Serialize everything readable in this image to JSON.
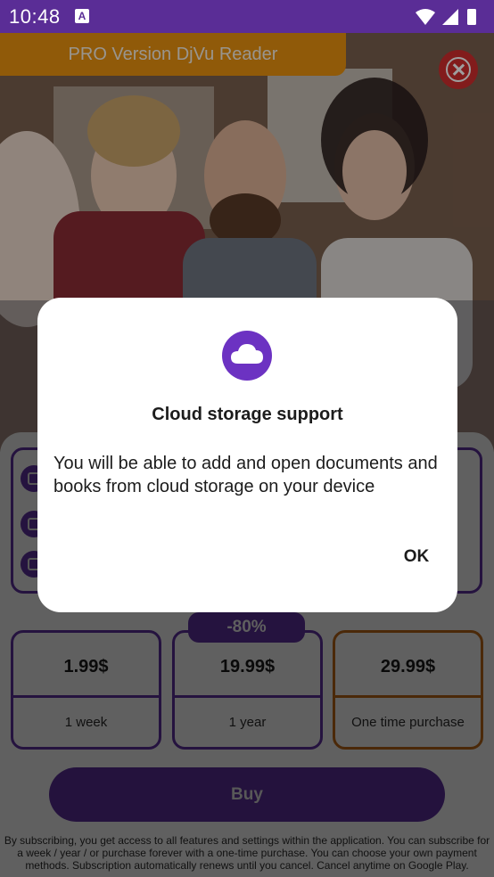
{
  "status_bar": {
    "time": "10:48",
    "notification_icon": "a-icon"
  },
  "header": {
    "title": "PRO Version DjVu Reader",
    "close_icon": "close-icon"
  },
  "plans": [
    {
      "price": "1.99$",
      "term": "1 week"
    },
    {
      "price": "19.99$",
      "term": "1 year",
      "badge": "-80%"
    },
    {
      "price": "29.99$",
      "term": "One time purchase"
    }
  ],
  "buy_label": "Buy",
  "legal_text": "By subscribing, you get access to all features and settings within the application. You can subscribe for a week / year / or purchase forever with a one-time purchase. You can choose your own payment methods. Subscription automatically renews until you cancel. Cancel anytime on Google Play.",
  "dialog": {
    "icon": "cloud-icon",
    "title": "Cloud storage support",
    "body": "You will be able to add and open documents and books from cloud storage on your device",
    "ok_label": "OK"
  },
  "colors": {
    "status_bar": "#5a2d96",
    "banner": "#e8910f",
    "close": "#d22e2e",
    "accent_purple": "#6c32c2",
    "orange_plan": "#e07d10"
  }
}
